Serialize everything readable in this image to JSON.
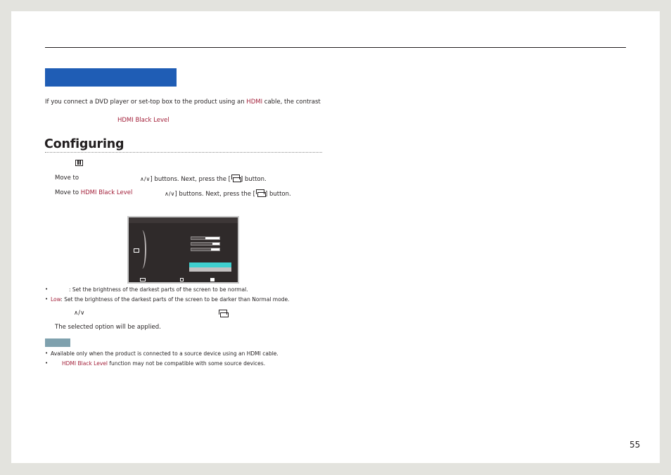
{
  "intro": {
    "line1_a": "If you connect a DVD player or set-top box to the product using an ",
    "line1_hdmi": "HDMI",
    "line1_b": " cable, the contrast",
    "line2_red": "HDMI Black Level"
  },
  "section_title": "Configuring",
  "steps": {
    "step1_a": "Move to",
    "step1_b": "] buttons. Next, press the [",
    "step1_c": "] button.",
    "step2_a": "Move to ",
    "step2_red": "HDMI Black Level",
    "step2_b": "] buttons. Next, press the [",
    "step2_c": "] button.",
    "updown_glyph": "∧/∨",
    "step4": "The selected option will be applied."
  },
  "options": {
    "normal_text": ": Set the brightness of the darkest parts of the screen to be normal.",
    "low_label": "Low",
    "low_text": ": Set the brightness of the darkest parts of the screen to be darker than Normal mode."
  },
  "notes": {
    "note1": "Available only when the product is connected to a source device using an HDMI cable.",
    "note2_red": "HDMI Black Level",
    "note2_text": " function may not be compatible with some source devices."
  },
  "bullet": "•",
  "page_number": "55",
  "icons": {
    "menu": "menu-icon",
    "updown": "up-down-icon",
    "enter": "source-enter-icon"
  },
  "colors": {
    "accent_blue": "#1f5db5",
    "highlight_red": "#a3203a",
    "osd_selected": "#3fd0cf",
    "note_tag": "#7fa1ae"
  }
}
